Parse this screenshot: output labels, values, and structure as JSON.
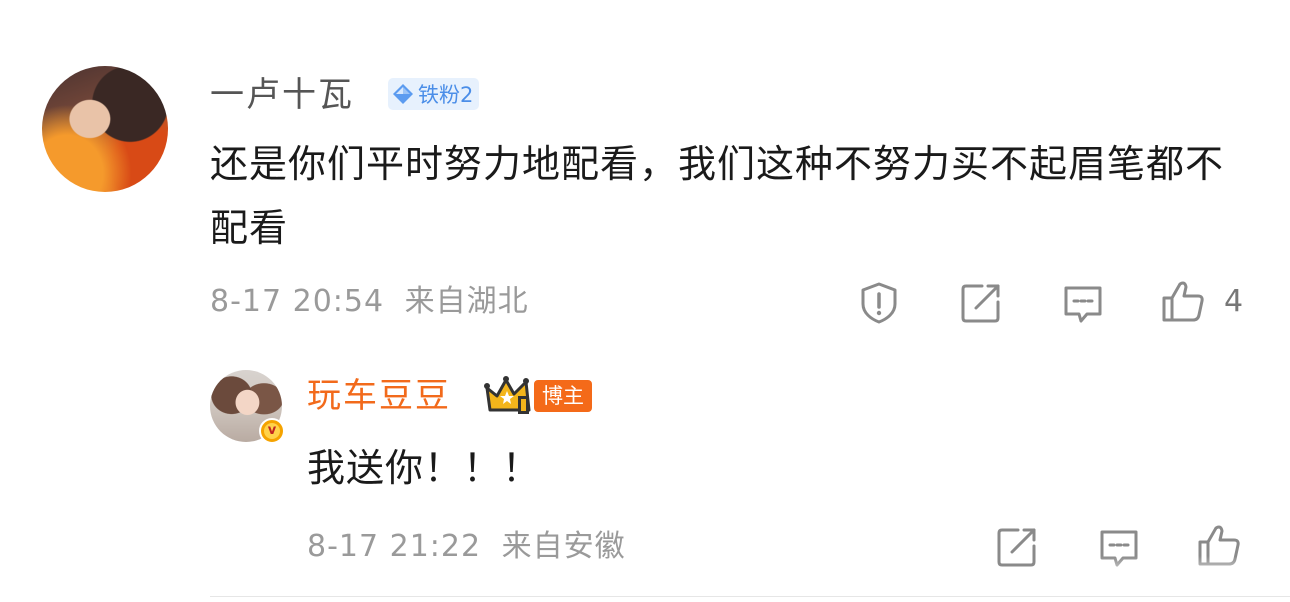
{
  "comment": {
    "username": "一卢十瓦",
    "fan_badge": "铁粉2",
    "text": "还是你们平时努力地配看，我们这种不努力买不起眉笔都不配看",
    "time": "8-17 20:54",
    "location": "来自湖北",
    "like_count": "4",
    "icons": [
      "report-icon",
      "repost-icon",
      "reply-icon",
      "like-icon"
    ]
  },
  "reply": {
    "username": "玩车豆豆",
    "verified_mark": "v",
    "badge": "博主",
    "text": "我送你！！！",
    "time": "8-17 21:22",
    "location": "来自安徽",
    "icons": [
      "repost-icon",
      "reply-icon",
      "like-icon"
    ]
  },
  "colors": {
    "username_main": "#555555",
    "username_reply": "#f26a1b",
    "fan_badge_bg": "#e7f1fd",
    "fan_badge_text": "#4b8ee8",
    "blogger_badge_bg": "#f46a19",
    "meta_text": "#9a9a9a",
    "icon_stroke": "#8a8a8a"
  }
}
